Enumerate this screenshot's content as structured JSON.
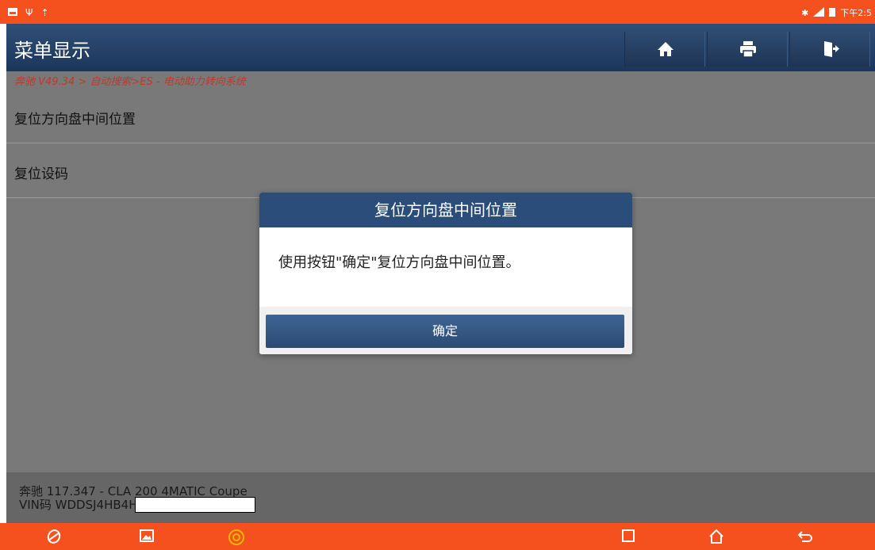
{
  "status_bar": {
    "time": "下午2:5",
    "icons": [
      "image-icon",
      "usb-icon",
      "upload-icon",
      "bluetooth-icon",
      "signal-icon",
      "battery-icon"
    ]
  },
  "header": {
    "title": "菜单显示",
    "buttons": [
      "home-icon",
      "print-icon",
      "exit-icon"
    ]
  },
  "breadcrumb": "奔驰 V49.34 > 自动搜索>ES - 电动助力转向系统",
  "menu": {
    "items": [
      {
        "label": "复位方向盘中间位置"
      },
      {
        "label": "复位设码"
      }
    ]
  },
  "dialog": {
    "title": "复位方向盘中间位置",
    "message": "使用按钮\"确定\"复位方向盘中间位置。",
    "ok_label": "确定"
  },
  "vehicle_info": {
    "model": "奔驰 117.347 - CLA 200 4MATIC Coupe",
    "vin": "VIN码 WDDSJ4HB4H"
  },
  "nav_bar": {
    "icons": [
      "browser-icon",
      "gallery-icon",
      "diagnostic-app-icon",
      "recent-apps-icon",
      "home-nav-icon",
      "back-icon"
    ]
  },
  "colors": {
    "accent": "#f4511e",
    "header_blue": "#2b4d7a",
    "breadcrumb_red": "#c0392b"
  }
}
